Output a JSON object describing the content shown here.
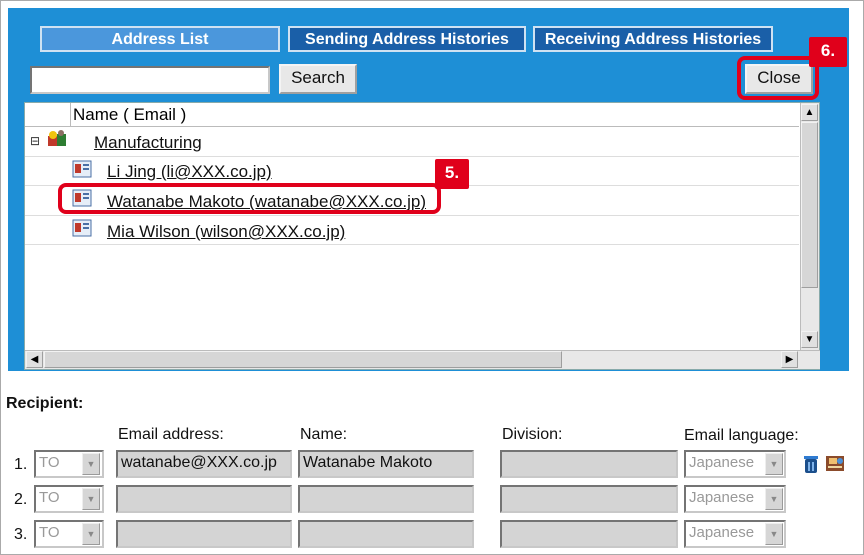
{
  "tabs": [
    {
      "label": "Address List",
      "active": true
    },
    {
      "label": "Sending Address Histories",
      "active": false
    },
    {
      "label": "Receiving Address Histories",
      "active": false
    }
  ],
  "search": {
    "value": "",
    "button_label": "Search"
  },
  "close_label": "Close",
  "list": {
    "column_header": "Name ( Email )",
    "group": {
      "label": "Manufacturing",
      "expand_glyph": "⊟"
    },
    "items": [
      {
        "label": "Li Jing (li@XXX.co.jp)"
      },
      {
        "label": "Watanabe Makoto (watanabe@XXX.co.jp)"
      },
      {
        "label": "Mia Wilson (wilson@XXX.co.jp)"
      }
    ]
  },
  "callouts": {
    "step5": "5.",
    "step6": "6."
  },
  "recipient": {
    "title": "Recipient:",
    "headers": {
      "email": "Email address:",
      "name": "Name:",
      "division": "Division:",
      "language": "Email language:"
    },
    "rows": [
      {
        "num": "1.",
        "type": "TO",
        "email": "watanabe@XXX.co.jp",
        "name": "Watanabe Makoto",
        "division": "",
        "language": "Japanese"
      },
      {
        "num": "2.",
        "type": "TO",
        "email": "",
        "name": "",
        "division": "",
        "language": "Japanese"
      },
      {
        "num": "3.",
        "type": "TO",
        "email": "",
        "name": "",
        "division": "",
        "language": "Japanese"
      }
    ]
  },
  "colors": {
    "panel": "#1e8fd6",
    "tab_active": "#4b97dc",
    "tab_inactive": "#1a5fa8",
    "callout": "#e0001b"
  }
}
